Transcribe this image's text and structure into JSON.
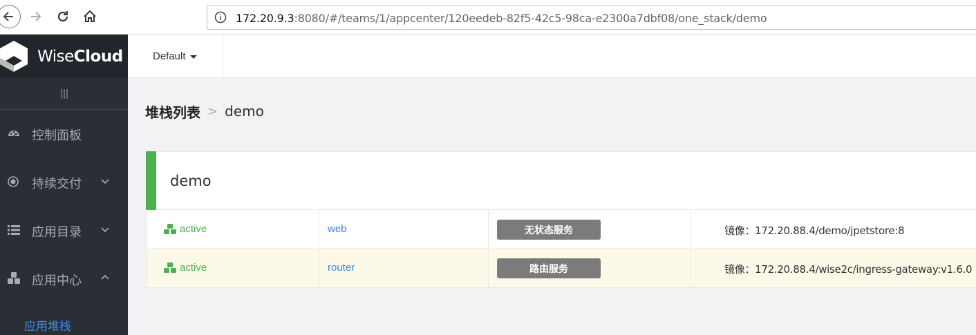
{
  "browser": {
    "url_host": "172.20.9.3",
    "url_rest": ":8080/#/teams/1/appcenter/120eedeb-82f5-42c5-98ca-e2300a7dbf08/one_stack/demo"
  },
  "brand": {
    "name_light": "Wise",
    "name_bold": "Cloud"
  },
  "sidebar": {
    "items": [
      {
        "label": "控制面板",
        "icon": "dashboard-icon"
      },
      {
        "label": "持续交付",
        "icon": "target-icon",
        "chevron": "down"
      },
      {
        "label": "应用目录",
        "icon": "list-icon",
        "chevron": "down"
      },
      {
        "label": "应用中心",
        "icon": "cubes-icon",
        "chevron": "up"
      }
    ],
    "submenu": {
      "label": "应用堆栈",
      "active": true
    }
  },
  "header": {
    "environment": "Default"
  },
  "breadcrumb": {
    "root": "堆栈列表",
    "separator": ">",
    "current": "demo"
  },
  "stack": {
    "title": "demo",
    "services": [
      {
        "status": "active",
        "name": "web",
        "type": "无状态服务",
        "image": "镜像：172.20.88.4/demo/jpetstore:8"
      },
      {
        "status": "active",
        "name": "router",
        "type": "路由服务",
        "image": "镜像：172.20.88.4/wise2c/ingress-gateway:v1.6.0"
      }
    ]
  },
  "colors": {
    "sidebar_bg": "#2a2f36",
    "accent_green": "#4cb050",
    "link_blue": "#3b86d8",
    "badge_gray": "#7b7b7b",
    "highlight_row": "#fdf9e9"
  }
}
